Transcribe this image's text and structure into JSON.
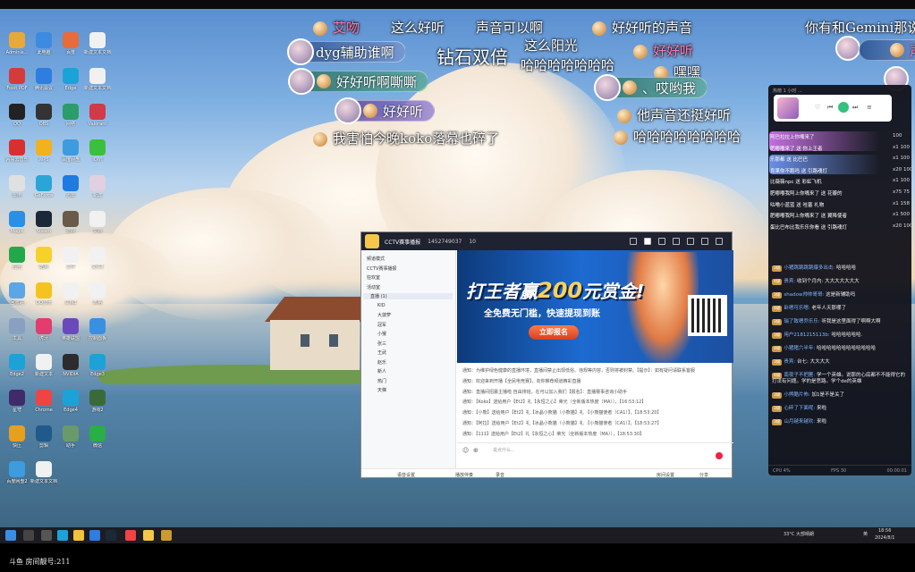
{
  "desktop": {
    "icons": [
      {
        "label": "Adminis...",
        "color": "#e8a93b"
      },
      {
        "label": "此电脑",
        "color": "#3d8be0"
      },
      {
        "label": "百度",
        "color": "#e86b3b"
      },
      {
        "label": "新建文本文档",
        "color": "#f1f1f1"
      },
      {
        "label": "Foxit PDF",
        "color": "#d63b3b"
      },
      {
        "label": "腾讯会议",
        "color": "#2e7de0"
      },
      {
        "label": "Edge",
        "color": "#1ba3d8"
      },
      {
        "label": "新建文本文档(2)",
        "color": "#f1f1f1"
      },
      {
        "label": "QQ",
        "color": "#222"
      },
      {
        "label": "OBS",
        "color": "#333"
      },
      {
        "label": "网络",
        "color": "#2a9d6a"
      },
      {
        "label": "Valorant",
        "color": "#d33a48"
      },
      {
        "label": "网易云音乐",
        "color": "#d8302f"
      },
      {
        "label": "WPS",
        "color": "#f2b21e"
      },
      {
        "label": "百度网盘",
        "color": "#3d9be0"
      },
      {
        "label": "iQIYI",
        "color": "#3bbf3e"
      },
      {
        "label": "雷电",
        "color": "#e0e0e0"
      },
      {
        "label": "GeForce",
        "color": "#2aa6d6"
      },
      {
        "label": "迅雷",
        "color": "#1d7be2"
      },
      {
        "label": "新建",
        "color": "#e0d0e0"
      },
      {
        "label": "Magic",
        "color": "#2a8fe6"
      },
      {
        "label": "Steam",
        "color": "#1b2838"
      },
      {
        "label": "游戏",
        "color": "#6a5a4a"
      },
      {
        "label": "文档",
        "color": "#f1f1f1"
      },
      {
        "label": "应用",
        "color": "#22a84a"
      },
      {
        "label": "酷狗",
        "color": "#f7d02c"
      },
      {
        "label": "文件",
        "color": "#f1f1f1"
      },
      {
        "label": "文件2",
        "color": "#f1f1f1"
      },
      {
        "label": "回收站",
        "color": "#5aa6e6"
      },
      {
        "label": "QQ音乐",
        "color": "#f5c31e"
      },
      {
        "label": "文档3",
        "color": "#f1f1f1"
      },
      {
        "label": "表格",
        "color": "#f1f1f1"
      },
      {
        "label": "工具",
        "color": "#8aa0c0"
      },
      {
        "label": "虎牙",
        "color": "#e23d6e"
      },
      {
        "label": "英雄联盟",
        "color": "#6a4ab8"
      },
      {
        "label": "控制面板",
        "color": "#3a90e0"
      },
      {
        "label": "Edge2",
        "color": "#1ba3d8"
      },
      {
        "label": "新建文本",
        "color": "#f1f1f1"
      },
      {
        "label": "NVIDIA",
        "color": "#2c2c2c"
      },
      {
        "label": "Edge3",
        "color": "#1ba3d8"
      },
      {
        "label": "星穹",
        "color": "#402a6a"
      },
      {
        "label": "Chrome",
        "color": "#e44"
      },
      {
        "label": "Edge4",
        "color": "#1ba3d8"
      },
      {
        "label": "游戏2",
        "color": "#3a6a3a"
      },
      {
        "label": "快压",
        "color": "#e6a020"
      },
      {
        "label": "剪辑",
        "color": "#1f5a8a"
      },
      {
        "label": "助手",
        "color": "#6a9a6a"
      },
      {
        "label": "微信",
        "color": "#2aae48"
      },
      {
        "label": "百度网盘2",
        "color": "#3d9be0"
      },
      {
        "label": "新建文本文档(3)",
        "color": "#f1f1f1"
      }
    ]
  },
  "danmaku": {
    "top_left_user": "艾吻",
    "msg1": "这么好听",
    "msg2": "声音可以啊",
    "msg3": "好好听的声音",
    "msg4": "你有和Gemini那说",
    "pill1": "dyg辅助谁啊",
    "big1": "钻石双倍",
    "msg5": "这么阳光",
    "msg6": "哈哈哈哈哈哈哈",
    "msg7_user": "好好听",
    "pill2": "好好听啊嘶嘶",
    "msg8": "嘿嘿",
    "pill3": "、哎哟我",
    "pill4": "好好听",
    "msg9": "他声音还挺好听",
    "msg10": "我害怕今晚koko落幕也碎了",
    "msg11": "哈哈哈哈哈哈哈哈",
    "tr_pill": "声"
  },
  "chat_panel": {
    "head": "热榜 1 小时 ...",
    "gifts": [
      {
        "text": "阿巴拉拉上你嘴来了",
        "count": "100"
      },
      {
        "text": "肥嘟嘟来了 送 你上王者",
        "count": "x1  100"
      },
      {
        "text": "乐那都 送 比巴巴",
        "count": "x1 100"
      },
      {
        "text": "良果你不跑吗 送 引路魂灯",
        "count": "x20  100"
      },
      {
        "text": "比薇薇npc 送 彩虹飞机",
        "count": "x1  100"
      },
      {
        "text": "肥嘟嘟我阿上你嘴来了 送 花瓣的",
        "count": "x75  75"
      },
      {
        "text": "咕噜小蓝蓝 送 哇塞 礼物",
        "count": "x1  158"
      },
      {
        "text": "肥嘟嘟我阿上你嘴来了 送 翼降使者",
        "count": "x1  500"
      },
      {
        "text": "蛋比巴布比我乐乐你看 送 引路魂灯",
        "count": "x20  100"
      }
    ],
    "messages": [
      {
        "lv": "3级",
        "name": "小猪跳跳跳跳爆多出击",
        "text": "哈哈哈哈"
      },
      {
        "lv": "4级",
        "name": "贵宾",
        "text": "收到个月内: 大大大大大大大"
      },
      {
        "lv": "3级",
        "name": "shadow帅帅哥哥",
        "text": "这是新辅助吗"
      },
      {
        "lv": "4级",
        "name": "卧嗯可乐嗯",
        "text": "老年人天那哪了"
      },
      {
        "lv": "3级",
        "name": "瑞了致嗯乔乐乐",
        "text": "听我是这里面得了啊啊大啊"
      },
      {
        "lv": "3级",
        "name": "用户2181215113b",
        "text": "哈哈哈哈哈哈."
      },
      {
        "lv": "4级",
        "name": "小猪猪六半年",
        "text": "哈哈哈哈哈哈哈哈哈哈哈哈"
      },
      {
        "lv": "3级",
        "name": "贵宾",
        "text": "台七: 大大大大"
      },
      {
        "lv": "4级",
        "name": "南夜子不把雁",
        "text": "学一个英雄。说那的心底都不不能得它的打法有问题。学的是思路。学个de的英雄"
      },
      {
        "lv": "3级",
        "name": "小熊酷片佈",
        "text": "加1是不是关了"
      },
      {
        "lv": "3级",
        "name": "心碎了下面呢",
        "text": "来啦"
      },
      {
        "lv": "3级",
        "name": "山月越来越欢",
        "text": "来啦"
      }
    ],
    "foot_left": "CPU 4%",
    "foot_mid": "FPS 30",
    "foot_right": "00:00:01"
  },
  "yy": {
    "title": "CCTV赛事播报",
    "room_id": "1452749037",
    "count": "10",
    "tree": [
      "频道模式",
      "CCTV赛事播报",
      "狂欢室",
      "活动室",
      "直播 (1)",
      "KID",
      "大菠萝",
      "冠军",
      "小猴",
      "张三",
      "王武",
      "赵乐",
      "新人",
      "热门",
      "天梯"
    ],
    "banner_title_a": "打王者赢",
    "banner_title_gold": "200",
    "banner_title_b": "元赏金!",
    "banner_sub": "全免费无门槛，快速提现到账",
    "banner_btn": "立即报名",
    "messages": [
      "通知：为维护绿色健康的直播环境，直播间禁止出现低俗、违规等内容，否则将被封禁。【提示】：如有疑问请联系客服",
      "通知：欢迎来到开播【全民电竞赛】，向你推荐频道精彩直播",
      "通知：直播间招募主播啦 自由排班，在可以加入我们【报名】：直播赛事咨询小助手",
      "通知：【Koko】送给用户【Et2】礼【永恒之心】荣光（全新版本热度（MA）），【16:53:12】",
      "通知：【小熊】送给用户【Et2】礼【冰晶小熊猫（小熊猫】礼 【小熊猫使者（CA1）】，【18:53:20】",
      "通知：【阿拉】送给用户【Et2】礼【冰晶小熊猫（小熊猫】礼 【小熊猫使者（CA1）】，【18:53:27】",
      "通知：【111】送给用户【Et2】礼【永恒之心】荣光（全新版本热度（MA）），【18:53:30】"
    ],
    "input_placeholder": "说点什么...",
    "bottom_items": [
      "语音设置",
      "播放伴奏",
      "录音",
      "房间设置",
      "分享"
    ]
  },
  "taskbar": {
    "weather": "33°C 大部晴朗",
    "time": "18:56",
    "date": "2024/8/1",
    "lang": "英"
  },
  "room_info": "斗鱼 房间靓号:211"
}
